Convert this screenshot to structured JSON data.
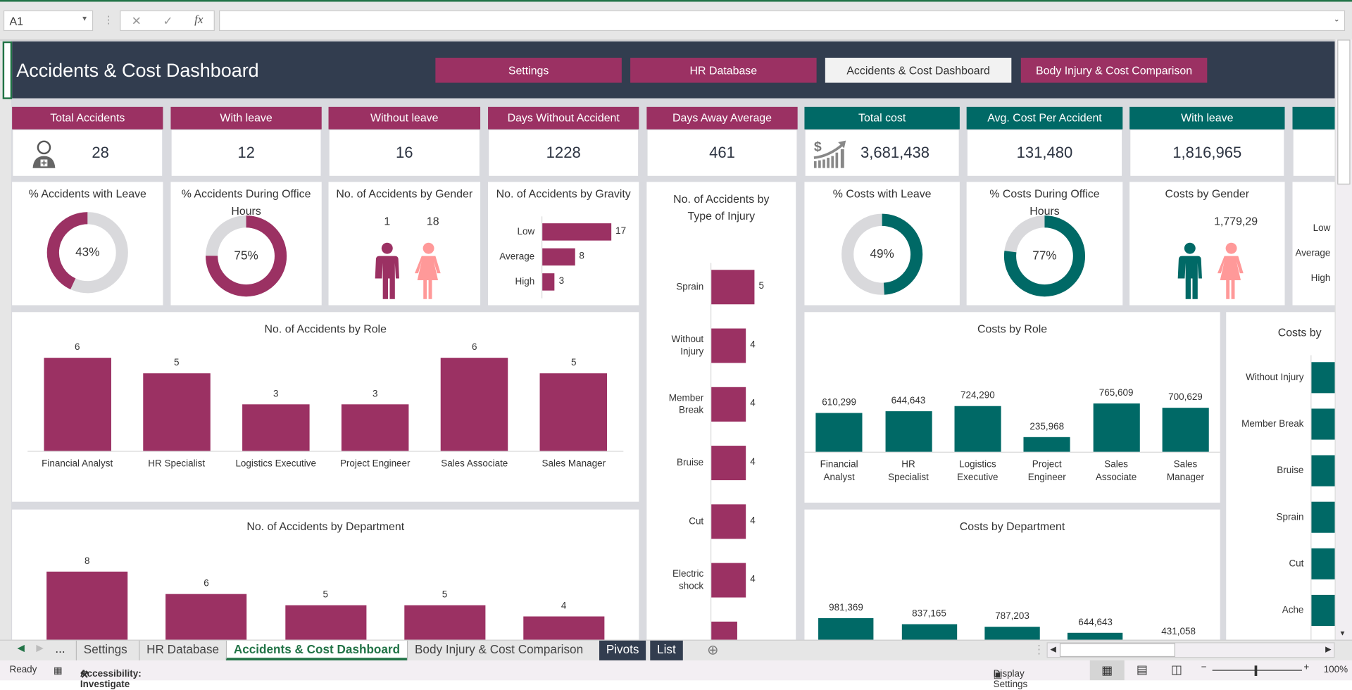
{
  "formula_bar": {
    "name_box": "A1",
    "formula": "",
    "fx_label": "fx",
    "cancel_icon": "✕",
    "enter_icon": "✓"
  },
  "header": {
    "title": "Accidents & Cost Dashboard",
    "nav": [
      {
        "label": "Settings"
      },
      {
        "label": "HR Database"
      },
      {
        "label": "Accidents & Cost Dashboard",
        "active": true
      },
      {
        "label": "Body Injury & Cost Comparison"
      }
    ]
  },
  "kpis": [
    {
      "label": "Total Accidents",
      "value": "28",
      "icon": "injured-person-icon"
    },
    {
      "label": "With leave",
      "value": "12"
    },
    {
      "label": "Without leave",
      "value": "16"
    },
    {
      "label": "Days Without Accident",
      "value": "1228"
    },
    {
      "label": "Days Away Average",
      "value": "461"
    },
    {
      "label": "Total cost",
      "value": "3,681,438",
      "icon": "money-growth-icon"
    },
    {
      "label": "Avg. Cost Per Accident",
      "value": "131,480"
    },
    {
      "label": "With leave",
      "value": "1,816,965"
    },
    {
      "label": "",
      "value": ""
    }
  ],
  "colors": {
    "accidents": "#9b3163",
    "costs": "#006966",
    "remainder": "#d9d9dc",
    "header": "#323d4f",
    "female": "#ff9999",
    "excel_green": "#217346"
  },
  "donuts": [
    {
      "title": "% Accidents with Leave",
      "percent": 43,
      "label": "43%",
      "color": "#9b3163"
    },
    {
      "title": "% Accidents During Office Hours",
      "percent": 75,
      "label": "75%",
      "color": "#9b3163"
    },
    {
      "title": "% Costs with Leave",
      "percent": 49,
      "label": "49%",
      "color": "#006966"
    },
    {
      "title": "% Costs During Office Hours",
      "percent": 77,
      "label": "77%",
      "color": "#006966"
    }
  ],
  "gender": [
    {
      "title": "No. of Accidents by Gender",
      "male": "1",
      "female": "18"
    },
    {
      "title": "Costs by Gender",
      "male": "",
      "female": "1,779,29"
    }
  ],
  "chart_data": [
    {
      "id": "gravity",
      "type": "bar",
      "orientation": "horizontal",
      "title": "No. of Accidents by Gravity",
      "categories": [
        "Low",
        "Average",
        "High"
      ],
      "values": [
        17,
        8,
        3
      ]
    },
    {
      "id": "injury",
      "type": "bar",
      "orientation": "horizontal",
      "title": "No. of Accidents by Type of Injury",
      "categories": [
        "Sprain",
        "Without Injury",
        "Member Break",
        "Bruise",
        "Cut",
        "Electric shock",
        ""
      ],
      "values": [
        5,
        4,
        4,
        4,
        4,
        4,
        null
      ]
    },
    {
      "id": "role",
      "type": "bar",
      "title": "No. of Accidents by Role",
      "categories": [
        "Financial Analyst",
        "HR Specialist",
        "Logistics Executive",
        "Project Engineer",
        "Sales Associate",
        "Sales Manager"
      ],
      "values": [
        6,
        5,
        3,
        3,
        6,
        5
      ]
    },
    {
      "id": "dept",
      "type": "bar",
      "title": "No. of Accidents by Department",
      "categories": [
        "",
        "",
        "",
        "",
        ""
      ],
      "values": [
        8,
        6,
        5,
        5,
        4
      ]
    },
    {
      "id": "cost_role",
      "type": "bar",
      "title": "Costs by Role",
      "categories": [
        "Financial Analyst",
        "HR Specialist",
        "Logistics Executive",
        "Project Engineer",
        "Sales Associate",
        "Sales Manager"
      ],
      "values": [
        610299,
        644643,
        724290,
        235968,
        765609,
        700629
      ],
      "labels": [
        "610,299",
        "644,643",
        "724,290",
        "235,968",
        "765,609",
        "700,629"
      ]
    },
    {
      "id": "cost_dept",
      "type": "bar",
      "title": "Costs by Department",
      "categories": [
        "",
        "",
        "",
        "",
        ""
      ],
      "values": [
        981369,
        837165,
        787203,
        644643,
        431058
      ],
      "labels": [
        "981,369",
        "837,165",
        "787,203",
        "644,643",
        "431,058"
      ]
    },
    {
      "id": "cost_injury",
      "type": "bar",
      "orientation": "horizontal",
      "title": "Costs by",
      "categories": [
        "Without Injury",
        "Member Break",
        "Bruise",
        "Sprain",
        "Cut",
        "Ache"
      ],
      "values": []
    },
    {
      "id": "cost_gravity",
      "type": "bar",
      "orientation": "horizontal",
      "title": "",
      "categories": [
        "Low",
        "Average",
        "High"
      ],
      "values": []
    }
  ],
  "sheet_tabs": [
    {
      "label": "Settings"
    },
    {
      "label": "HR Database"
    },
    {
      "label": "Accidents & Cost Dashboard",
      "active": true
    },
    {
      "label": "Body Injury & Cost Comparison"
    },
    {
      "label": "Pivots"
    },
    {
      "label": "List"
    }
  ],
  "tab_more": "...",
  "status": {
    "ready": "Ready",
    "accessibility": "Accessibility: Investigate",
    "display_settings": "Display Settings",
    "zoom": "100%"
  }
}
